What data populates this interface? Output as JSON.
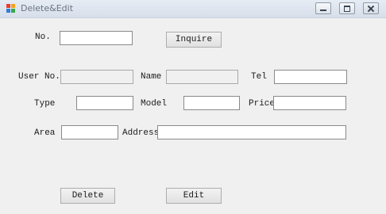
{
  "window": {
    "title": "Delete&Edit",
    "controls": {
      "minimize": "minimize-icon",
      "maximize": "maximize-icon",
      "close": "close-icon"
    }
  },
  "form": {
    "no_label": "No.",
    "no_value": "",
    "inquire_label": "Inquire",
    "user_no_label": "User No.",
    "user_no_value": "",
    "name_label": "Name",
    "name_value": "",
    "tel_label": "Tel",
    "tel_value": "",
    "type_label": "Type",
    "type_value": "",
    "model_label": "Model",
    "model_value": "",
    "price_label": "Price",
    "price_value": "",
    "area_label": "Area",
    "area_value": "",
    "address_label": "Address",
    "address_value": "",
    "delete_label": "Delete",
    "edit_label": "Edit"
  },
  "colors": {
    "window_bg": "#f0f0f0",
    "titlebar": "#dde4ee"
  }
}
